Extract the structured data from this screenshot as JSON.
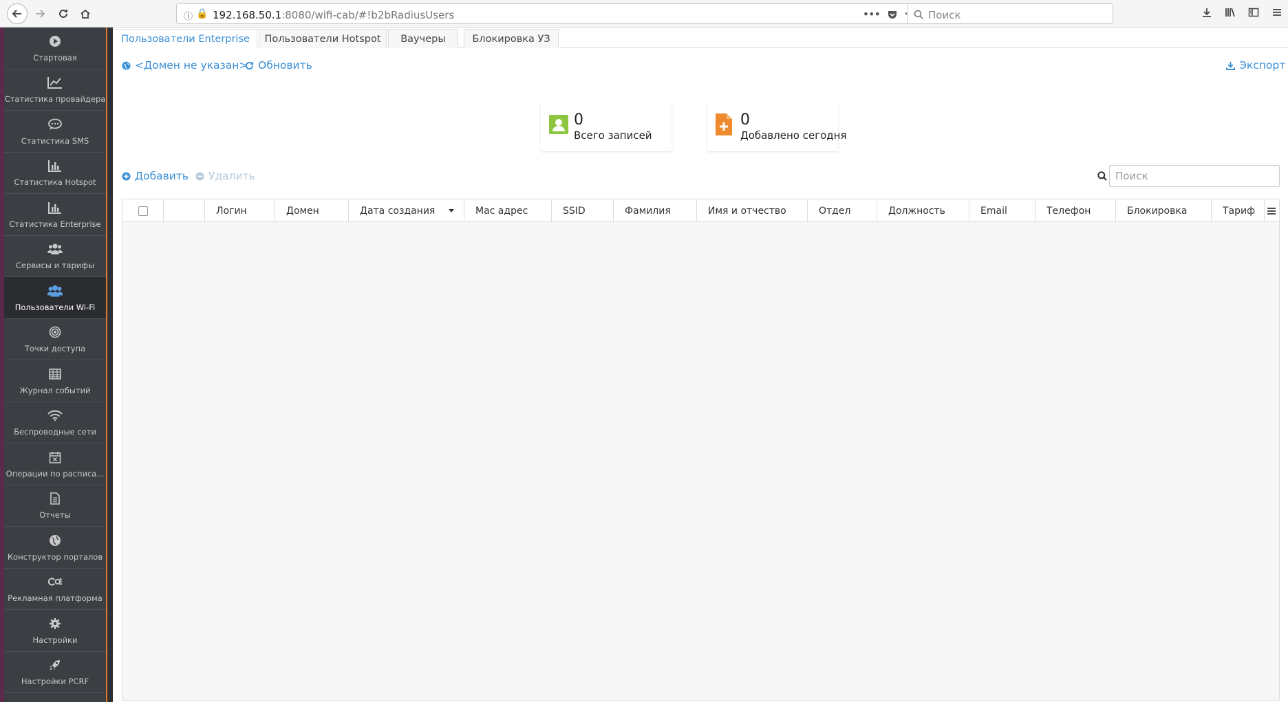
{
  "browser": {
    "url_host": "192.168.50.1",
    "url_rest": ":8080/wifi-cab/#!b2bRadiusUsers",
    "search_placeholder": "Поиск"
  },
  "sidebar": {
    "items": [
      {
        "label": "Стартовая",
        "icon": "play-circle-icon"
      },
      {
        "label": "Статистика провайдера",
        "icon": "line-chart-icon"
      },
      {
        "label": "Статистика SMS",
        "icon": "chat-bubble-icon"
      },
      {
        "label": "Статистика Hotspot",
        "icon": "bar-chart-icon"
      },
      {
        "label": "Статистика Enterprise",
        "icon": "bar-chart-icon"
      },
      {
        "label": "Сервисы и тарифы",
        "icon": "users-icon"
      },
      {
        "label": "Пользователи Wi-Fi",
        "icon": "users-icon",
        "active": true
      },
      {
        "label": "Точки доступа",
        "icon": "target-icon"
      },
      {
        "label": "Журнал событий",
        "icon": "table-icon"
      },
      {
        "label": "Беспроводные сети",
        "icon": "wifi-icon"
      },
      {
        "label": "Операции по расписа...",
        "icon": "calendar-x-icon"
      },
      {
        "label": "Отчеты",
        "icon": "document-icon"
      },
      {
        "label": "Конструктор порталов",
        "icon": "globe-icon"
      },
      {
        "label": "Рекламная платформа",
        "icon": "ad-icon"
      },
      {
        "label": "Настройки",
        "icon": "gear-icon"
      },
      {
        "label": "Настройки PCRF",
        "icon": "rocket-icon"
      }
    ]
  },
  "tabs": [
    {
      "label": "Пользователи Enterprise",
      "active": true
    },
    {
      "label": "Пользователи Hotspot"
    },
    {
      "label": "Ваучеры"
    },
    {
      "label": "Блокировка УЗ"
    }
  ],
  "toolbar": {
    "domain_label": "<Домен не указан>",
    "refresh_label": "Обновить",
    "export_label": "Экспорт",
    "add_label": "Добавить",
    "delete_label": "Удалить",
    "search_placeholder": "Поиск"
  },
  "stats": {
    "total": {
      "value": "0",
      "label": "Всего записей"
    },
    "today": {
      "value": "0",
      "label": "Добавлено сегодня"
    }
  },
  "table": {
    "columns": [
      "Логин",
      "Домен",
      "Дата создания",
      "Mac адрес",
      "SSID",
      "Фамилия",
      "Имя и отчество",
      "Отдел",
      "Должность",
      "Email",
      "Телефон",
      "Блокировка",
      "Тариф"
    ],
    "rows": []
  },
  "colors": {
    "accent": "#3a8fd6",
    "sidebar_bg": "#3b3e42",
    "stat_green": "#8cc63f",
    "stat_orange": "#ef8a2e"
  }
}
